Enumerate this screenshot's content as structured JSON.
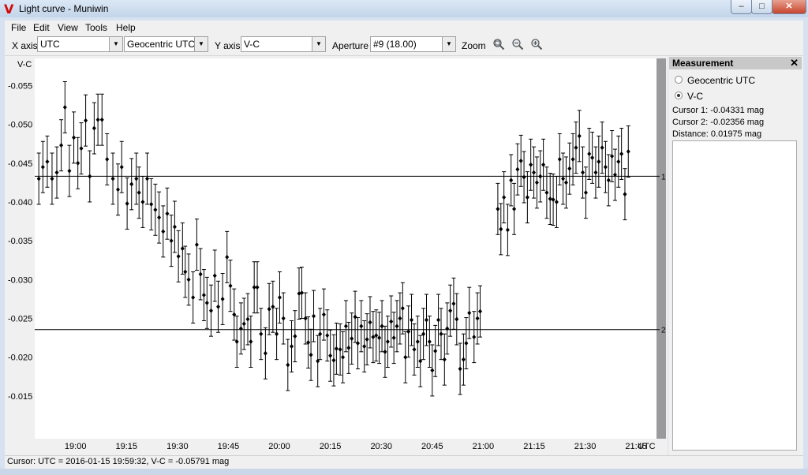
{
  "window": {
    "title": "Light curve - Muniwin",
    "app_icon_glyph": "V",
    "minimize": "–",
    "maximize": "□",
    "close": "✕"
  },
  "menu": [
    {
      "label": "File"
    },
    {
      "label": "Edit"
    },
    {
      "label": "View"
    },
    {
      "label": "Tools"
    },
    {
      "label": "Help"
    }
  ],
  "toolbar": {
    "x_axis_label": "X axis",
    "x_axis_value": "UTC",
    "x_axis_secondary": "Geocentric UTC",
    "y_axis_label": "Y axis",
    "y_axis_value": "V-C",
    "aperture_label": "Aperture",
    "aperture_value": "#9 (18.00)",
    "zoom_label": "Zoom",
    "zoom_icons": [
      "zoom-fit-icon",
      "zoom-out-icon",
      "zoom-in-icon"
    ]
  },
  "panel": {
    "title": "Measurement",
    "radio_1": "Geocentric UTC",
    "radio_2": "V-C",
    "selected": "V-C",
    "cursor1": "Cursor 1: -0.04331 mag",
    "cursor2": "Cursor 2: -0.02356 mag",
    "distance": "Distance: 0.01975 mag"
  },
  "status": {
    "text": "Cursor: UTC = 2016-01-15 19:59:32, V-C = -0.05791 mag"
  },
  "chart_data": {
    "type": "scatter",
    "ylabel": "V-C",
    "xlabel": "UTC",
    "y_reversed": true,
    "ylim": [
      -0.0585,
      -0.0095
    ],
    "xlim_minutes": [
      1128,
      1311
    ],
    "y_ticks": [
      "-0.055",
      "-0.050",
      "-0.045",
      "-0.040",
      "-0.035",
      "-0.030",
      "-0.025",
      "-0.020",
      "-0.015"
    ],
    "y_tick_values": [
      -0.055,
      -0.05,
      -0.045,
      -0.04,
      -0.035,
      -0.03,
      -0.025,
      -0.02,
      -0.015
    ],
    "x_ticks": [
      "19:00",
      "19:15",
      "19:30",
      "19:45",
      "20:00",
      "20:15",
      "20:30",
      "20:45",
      "21:00",
      "21:15",
      "21:30",
      "21:45"
    ],
    "x_tick_minutes": [
      1140,
      1155,
      1170,
      1185,
      1200,
      1215,
      1230,
      1245,
      1260,
      1275,
      1290,
      1305
    ],
    "cursors": [
      {
        "label": "1",
        "value": -0.04331
      },
      {
        "label": "2",
        "value": -0.02356
      }
    ],
    "error_bar": 0.0033,
    "points": [
      [
        1129.2,
        -0.043
      ],
      [
        1130.4,
        -0.0445
      ],
      [
        1131.7,
        -0.0452
      ],
      [
        1133.1,
        -0.043
      ],
      [
        1134.5,
        -0.0438
      ],
      [
        1135.8,
        -0.0473
      ],
      [
        1136.9,
        -0.0522
      ],
      [
        1138.2,
        -0.044
      ],
      [
        1139.5,
        -0.0483
      ],
      [
        1140.7,
        -0.045
      ],
      [
        1141.7,
        -0.0469
      ],
      [
        1143.0,
        -0.0505
      ],
      [
        1144.2,
        -0.0433
      ],
      [
        1145.5,
        -0.0495
      ],
      [
        1146.6,
        -0.0506
      ],
      [
        1147.8,
        -0.0506
      ],
      [
        1149.3,
        -0.0455
      ],
      [
        1151.0,
        -0.043
      ],
      [
        1152.5,
        -0.0416
      ],
      [
        1153.6,
        -0.0445
      ],
      [
        1155.2,
        -0.0398
      ],
      [
        1156.5,
        -0.0423
      ],
      [
        1157.9,
        -0.043
      ],
      [
        1158.7,
        -0.0412
      ],
      [
        1159.8,
        -0.04
      ],
      [
        1161.1,
        -0.043
      ],
      [
        1162.3,
        -0.0397
      ],
      [
        1163.5,
        -0.039
      ],
      [
        1164.6,
        -0.038
      ],
      [
        1165.8,
        -0.0362
      ],
      [
        1167.0,
        -0.0385
      ],
      [
        1168.2,
        -0.035
      ],
      [
        1169.2,
        -0.0368
      ],
      [
        1170.3,
        -0.033
      ],
      [
        1171.5,
        -0.034
      ],
      [
        1172.3,
        -0.031
      ],
      [
        1173.3,
        -0.03
      ],
      [
        1174.6,
        -0.0277
      ],
      [
        1175.7,
        -0.0345
      ],
      [
        1176.8,
        -0.0307
      ],
      [
        1177.8,
        -0.028
      ],
      [
        1178.7,
        -0.027
      ],
      [
        1179.9,
        -0.026
      ],
      [
        1181.0,
        -0.0305
      ],
      [
        1182.0,
        -0.0265
      ],
      [
        1183.3,
        -0.0275
      ],
      [
        1184.6,
        -0.0329
      ],
      [
        1185.6,
        -0.0292
      ],
      [
        1186.7,
        -0.0255
      ],
      [
        1187.5,
        -0.022
      ],
      [
        1188.7,
        -0.0237
      ],
      [
        1189.6,
        -0.0243
      ],
      [
        1190.7,
        -0.0249
      ],
      [
        1191.6,
        -0.022
      ],
      [
        1192.6,
        -0.029
      ],
      [
        1193.5,
        -0.029
      ],
      [
        1194.6,
        -0.023
      ],
      [
        1195.9,
        -0.0205
      ],
      [
        1197.0,
        -0.0262
      ],
      [
        1198.1,
        -0.0265
      ],
      [
        1199.2,
        -0.023
      ],
      [
        1200.1,
        -0.0277
      ],
      [
        1201.2,
        -0.025
      ],
      [
        1202.5,
        -0.019
      ],
      [
        1203.6,
        -0.0214
      ],
      [
        1204.6,
        -0.0227
      ],
      [
        1205.8,
        -0.0282
      ],
      [
        1206.6,
        -0.0283
      ],
      [
        1207.7,
        -0.025
      ],
      [
        1208.5,
        -0.0219
      ],
      [
        1209.3,
        -0.0203
      ],
      [
        1210.1,
        -0.0253
      ],
      [
        1211.3,
        -0.0195
      ],
      [
        1212.0,
        -0.023
      ],
      [
        1213.1,
        -0.0255
      ],
      [
        1214.1,
        -0.0228
      ],
      [
        1215.0,
        -0.0202
      ],
      [
        1216.0,
        -0.0196
      ],
      [
        1216.8,
        -0.0211
      ],
      [
        1217.9,
        -0.021
      ],
      [
        1218.7,
        -0.02
      ],
      [
        1219.6,
        -0.024
      ],
      [
        1220.4,
        -0.0212
      ],
      [
        1221.3,
        -0.0224
      ],
      [
        1222.3,
        -0.0252
      ],
      [
        1223.1,
        -0.0218
      ],
      [
        1224.1,
        -0.024
      ],
      [
        1225.0,
        -0.0214
      ],
      [
        1225.8,
        -0.0223
      ],
      [
        1226.7,
        -0.0245
      ],
      [
        1227.6,
        -0.0226
      ],
      [
        1228.5,
        -0.0228
      ],
      [
        1229.4,
        -0.0225
      ],
      [
        1230.2,
        -0.024
      ],
      [
        1231.1,
        -0.0207
      ],
      [
        1231.9,
        -0.022
      ],
      [
        1232.9,
        -0.0246
      ],
      [
        1233.7,
        -0.0225
      ],
      [
        1234.6,
        -0.024
      ],
      [
        1235.5,
        -0.025
      ],
      [
        1236.3,
        -0.0263
      ],
      [
        1237.1,
        -0.02
      ],
      [
        1238.0,
        -0.0233
      ],
      [
        1238.9,
        -0.0248
      ],
      [
        1239.7,
        -0.021
      ],
      [
        1240.7,
        -0.022
      ],
      [
        1241.5,
        -0.0195
      ],
      [
        1242.4,
        -0.023
      ],
      [
        1243.3,
        -0.0248
      ],
      [
        1244.2,
        -0.022
      ],
      [
        1245.0,
        -0.0183
      ],
      [
        1245.9,
        -0.0208
      ],
      [
        1246.8,
        -0.0248
      ],
      [
        1247.6,
        -0.023
      ],
      [
        1248.6,
        -0.0197
      ],
      [
        1249.4,
        -0.0237
      ],
      [
        1250.3,
        -0.026
      ],
      [
        1251.3,
        -0.0269
      ],
      [
        1252.2,
        -0.0249
      ],
      [
        1253.2,
        -0.0185
      ],
      [
        1254.2,
        -0.0197
      ],
      [
        1255.0,
        -0.0218
      ],
      [
        1255.9,
        -0.0257
      ],
      [
        1257.3,
        -0.0226
      ],
      [
        1258.3,
        -0.025
      ],
      [
        1259.1,
        -0.0259
      ],
      [
        1264.3,
        -0.0391
      ],
      [
        1265.2,
        -0.0365
      ],
      [
        1266.1,
        -0.0406
      ],
      [
        1267.2,
        -0.0364
      ],
      [
        1268.2,
        -0.0428
      ],
      [
        1269.1,
        -0.0391
      ],
      [
        1270.1,
        -0.0442
      ],
      [
        1271.1,
        -0.0453
      ],
      [
        1272.0,
        -0.0432
      ],
      [
        1273.0,
        -0.0406
      ],
      [
        1274.0,
        -0.0448
      ],
      [
        1274.9,
        -0.0438
      ],
      [
        1275.8,
        -0.0425
      ],
      [
        1276.8,
        -0.0433
      ],
      [
        1277.7,
        -0.0448
      ],
      [
        1278.7,
        -0.0412
      ],
      [
        1279.7,
        -0.0404
      ],
      [
        1280.6,
        -0.0403
      ],
      [
        1281.6,
        -0.04
      ],
      [
        1282.5,
        -0.0455
      ],
      [
        1283.5,
        -0.043
      ],
      [
        1284.4,
        -0.0425
      ],
      [
        1285.4,
        -0.0443
      ],
      [
        1286.4,
        -0.0455
      ],
      [
        1287.3,
        -0.047
      ],
      [
        1288.3,
        -0.0485
      ],
      [
        1289.3,
        -0.0438
      ],
      [
        1290.2,
        -0.0412
      ],
      [
        1291.2,
        -0.0462
      ],
      [
        1292.1,
        -0.0457
      ],
      [
        1293.1,
        -0.0438
      ],
      [
        1294.0,
        -0.0452
      ],
      [
        1295.0,
        -0.047
      ],
      [
        1296.0,
        -0.0445
      ],
      [
        1296.9,
        -0.0428
      ],
      [
        1297.9,
        -0.0459
      ],
      [
        1298.8,
        -0.0435
      ],
      [
        1299.8,
        -0.0452
      ],
      [
        1300.7,
        -0.0462
      ],
      [
        1301.7,
        -0.041
      ],
      [
        1302.7,
        -0.0465
      ]
    ]
  }
}
